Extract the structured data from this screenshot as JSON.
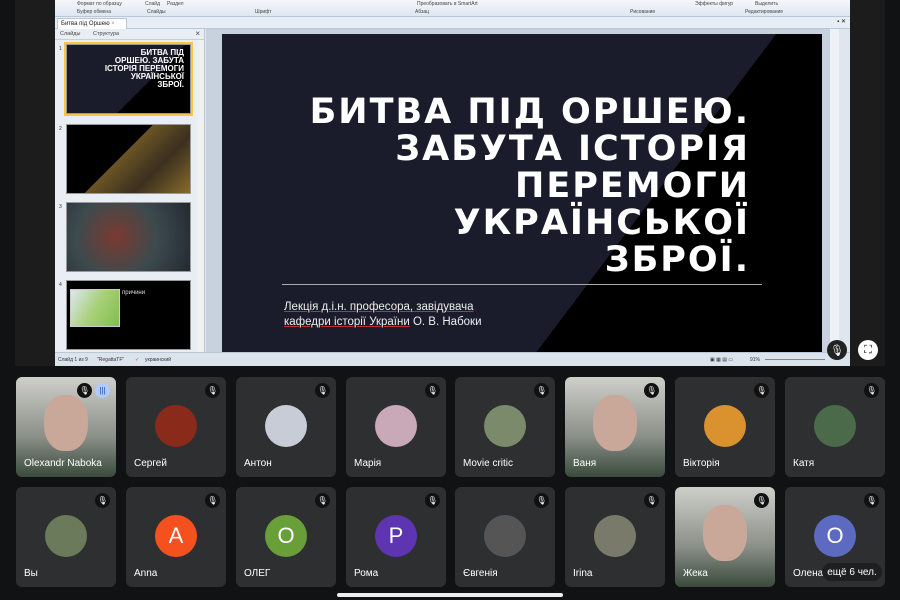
{
  "ppt": {
    "ribbon": {
      "format_painter": "Формат по образцу",
      "slide_btn": "Слайд",
      "section_btn": "Раздел",
      "convert_smartart": "Преобразовать в SmartArt",
      "shape_effects": "Эффекты фигур",
      "select": "Выделить",
      "groups": [
        "Буфер обмена",
        "Слайды",
        "Шрифт",
        "Абзац",
        "Рисование",
        "Редактирование"
      ]
    },
    "document_tab": "Битва під Оршею",
    "panel_tabs": [
      "Слайды",
      "Структура"
    ],
    "thumbnails": [
      {
        "num": "1",
        "title": "БИТВА ПІД ОРШЕЮ. ЗАБУТА ІСТОРІЯ ПЕРЕМОГИ УКРАЇНСЬКОЇ ЗБРОЇ."
      },
      {
        "num": "2"
      },
      {
        "num": "3"
      },
      {
        "num": "4",
        "label": "причини"
      }
    ],
    "slide": {
      "title_lines": [
        "БИТВА ПІД ОРШЕЮ.",
        "ЗАБУТА ІСТОРІЯ",
        "ПЕРЕМОГИ",
        "УКРАЇНСЬКОЇ",
        "ЗБРОЇ."
      ],
      "subtitle_line1": "Лекція д.і.н. професора, завідувача",
      "subtitle_line2a": "кафедри історії України",
      "subtitle_line2b": " О. В. Набоки"
    },
    "status": {
      "slide_of": "Слайд 1 из 9",
      "theme": "\"RegattaTF\"",
      "language": "украинский",
      "zoom": "91%"
    }
  },
  "overlay_icons": [
    "mic-off-icon",
    "fullscreen-icon"
  ],
  "participants": [
    {
      "name": "Olexandr Naboka",
      "type": "video",
      "speaking": true
    },
    {
      "name": "Сергей",
      "type": "photo",
      "color": "#8a2a1a"
    },
    {
      "name": "Антон",
      "type": "photo",
      "color": "#c7ccd6"
    },
    {
      "name": "Марія",
      "type": "photo",
      "color": "#c9a9b8"
    },
    {
      "name": "Movie critic",
      "type": "photo",
      "color": "#7a8a6a"
    },
    {
      "name": "Ваня",
      "type": "video"
    },
    {
      "name": "Вікторія",
      "type": "photo",
      "color": "#d9922e"
    },
    {
      "name": "Катя",
      "type": "photo",
      "color": "#4a6a4a"
    },
    {
      "name": "Вы",
      "type": "photo",
      "color": "#6a7a5a"
    },
    {
      "name": "Anna",
      "type": "letter",
      "letter": "A",
      "color": "#f4511e"
    },
    {
      "name": "ОЛЕГ",
      "type": "letter",
      "letter": "O",
      "color": "#689f38"
    },
    {
      "name": "Рома",
      "type": "letter",
      "letter": "P",
      "color": "#5e35b1"
    },
    {
      "name": "Євгенія",
      "type": "photo",
      "color": "#555"
    },
    {
      "name": "Irina",
      "type": "photo",
      "color": "#7a7a6a"
    },
    {
      "name": "Жека",
      "type": "video"
    },
    {
      "name": "Олена",
      "type": "letter",
      "letter": "O",
      "color": "#5c6bc0"
    }
  ],
  "more_participants": "ещё 6 чел."
}
